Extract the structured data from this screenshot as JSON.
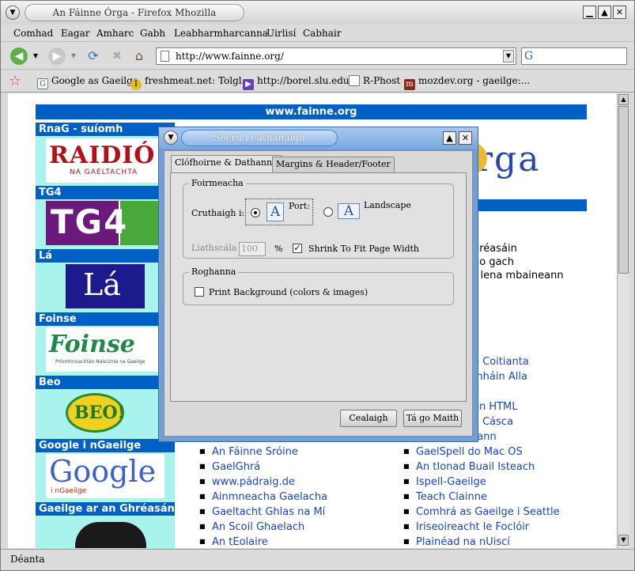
{
  "window": {
    "title": "An Fáinne Órga - Firefox Mhozilla"
  },
  "menu": [
    "Comhad",
    "Eagar",
    "Amharc",
    "Gabh",
    "Leabharmharcanna",
    "Uirlisí",
    "Cabhair"
  ],
  "address": {
    "url": "http://www.fainne.org/"
  },
  "bookmarks": [
    "Google as Gaeilge",
    "freshmeat.net: Tolgl...",
    "http://borel.slu.edu/",
    "R-Phost",
    "mozdev.org - gaeilge:..."
  ],
  "page": {
    "header": "www.fainne.org",
    "sidebar": [
      {
        "heading": "RnaG - suíomh",
        "logo": "RAIDIÓ",
        "logo_sub": "NA GAELTACHTA"
      },
      {
        "heading": "TG4",
        "logo": "TG4"
      },
      {
        "heading": "Lá",
        "logo": "Lá"
      },
      {
        "heading": "Foinse",
        "logo": "Foinse",
        "logo_sub": "Príomhnuachtán Náisiúnta na Gaeilge"
      },
      {
        "heading": "Beo",
        "logo": "BEO!"
      },
      {
        "heading": "Google i nGaeilge",
        "logo": "Google",
        "logo_sub": "i nGaeilge"
      },
      {
        "heading": "Gaeilge ar an Ghréasán"
      }
    ],
    "logo_fragment": "rga",
    "text_fragments": [
      "gréasáin",
      "do gach",
      "r lena mbaineann"
    ],
    "right_fragments": [
      "e Coitianta",
      "mháin Alla",
      "an HTML",
      "a Cásca",
      "rann"
    ],
    "links_left": [
      "An Fáinne Sróine",
      "GaelGhrá",
      "www.pádraig.de",
      "Ainmneacha Gaelacha",
      "Gaeltacht Ghlas na Mí",
      "An Scoil Ghaelach",
      "An tEolaire"
    ],
    "links_right": [
      "GaelSpell do Mac OS",
      "An tIonad Buail Isteach",
      "Ispell-Gaeilge",
      "Teach Clainne",
      "Comhrá as Gaeilge i Seattle",
      "Iriseoireacht le Foclóir",
      "Plainéad na nUiscí"
    ]
  },
  "status": "Déanta",
  "dialog": {
    "title": "Socrú Leathanaigh",
    "tabs": [
      "Clófhoirne & Dathanna",
      "Margins & Header/Footer"
    ],
    "format_group": "Foirmeacha",
    "orientation_label": "Cruthaigh i:",
    "portrait": "Port:",
    "landscape": "Landscape",
    "scale_label": "Liathscála",
    "scale_value": "100",
    "percent": "%",
    "shrink_label": "Shrink To Fit Page Width",
    "options_group": "Roghanna",
    "print_bg_label": "Print Background (colors & images)",
    "cancel": "Cealaigh",
    "ok": "Tá go Maith"
  }
}
